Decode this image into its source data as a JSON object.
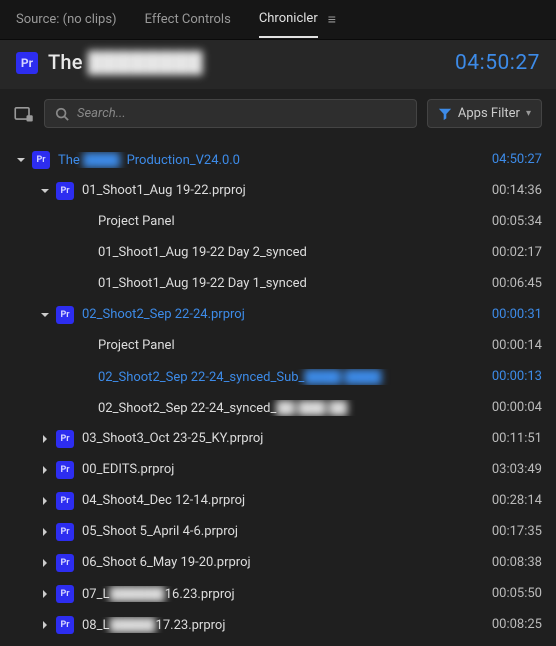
{
  "tabs": {
    "source": "Source: (no clips)",
    "effects": "Effect Controls",
    "chronicler": "Chronicler"
  },
  "header": {
    "title_prefix": "The",
    "title_blur": "████████",
    "total_time": "04:50:27"
  },
  "search": {
    "placeholder": "Search..."
  },
  "filter": {
    "label": "Apps Filter"
  },
  "root": {
    "label_prefix": "The",
    "label_blur": "████.",
    "label_suffix": "Production_V24.0.0",
    "duration": "04:50:27"
  },
  "items": [
    {
      "indent": 1,
      "disclosure": "down",
      "pr": true,
      "label": "01_Shoot1_Aug 19-22.prproj",
      "link": false,
      "duration": "00:14:36"
    },
    {
      "indent": 2,
      "disclosure": "none",
      "pr": false,
      "label": "Project Panel",
      "link": false,
      "duration": "00:05:34"
    },
    {
      "indent": 2,
      "disclosure": "none",
      "pr": false,
      "label": "01_Shoot1_Aug 19-22 Day 2_synced",
      "link": false,
      "duration": "00:02:17"
    },
    {
      "indent": 2,
      "disclosure": "none",
      "pr": false,
      "label": "01_Shoot1_Aug 19-22 Day 1_synced",
      "link": false,
      "duration": "00:06:45"
    },
    {
      "indent": 1,
      "disclosure": "down",
      "pr": true,
      "label": "02_Shoot2_Sep 22-24.prproj",
      "link": true,
      "duration": "00:00:31"
    },
    {
      "indent": 2,
      "disclosure": "none",
      "pr": false,
      "label": "Project Panel",
      "link": false,
      "duration": "00:00:14"
    },
    {
      "indent": 2,
      "disclosure": "none",
      "pr": false,
      "label_prefix": "02_Shoot2_Sep 22-24_synced_Sub_",
      "label_blur": "████  ████",
      "link": true,
      "duration": "00:00:13"
    },
    {
      "indent": 2,
      "disclosure": "none",
      "pr": false,
      "label_prefix": "02_Shoot2_Sep 22-24_synced_",
      "label_blur": "██  ███  ██",
      "link": false,
      "duration": "00:00:04"
    },
    {
      "indent": 1,
      "disclosure": "right",
      "pr": true,
      "label": "03_Shoot3_Oct 23-25_KY.prproj",
      "link": false,
      "duration": "00:11:51"
    },
    {
      "indent": 1,
      "disclosure": "right",
      "pr": true,
      "label": "00_EDITS.prproj",
      "link": false,
      "duration": "03:03:49"
    },
    {
      "indent": 1,
      "disclosure": "right",
      "pr": true,
      "label": "04_Shoot4_Dec 12-14.prproj",
      "link": false,
      "duration": "00:28:14"
    },
    {
      "indent": 1,
      "disclosure": "right",
      "pr": true,
      "label": "05_Shoot 5_April 4-6.prproj",
      "link": false,
      "duration": "00:17:35"
    },
    {
      "indent": 1,
      "disclosure": "right",
      "pr": true,
      "label": "06_Shoot 6_May 19-20.prproj",
      "link": false,
      "duration": "00:08:38"
    },
    {
      "indent": 1,
      "disclosure": "right",
      "pr": true,
      "label_prefix": "07_L",
      "label_blur": "██████",
      "label_suffix": "16.23.prproj",
      "link": false,
      "duration": "00:05:50"
    },
    {
      "indent": 1,
      "disclosure": "right",
      "pr": true,
      "label_prefix": "08_L",
      "label_blur": "█████",
      "label_suffix": "17.23.prproj",
      "link": false,
      "duration": "00:08:25"
    }
  ]
}
